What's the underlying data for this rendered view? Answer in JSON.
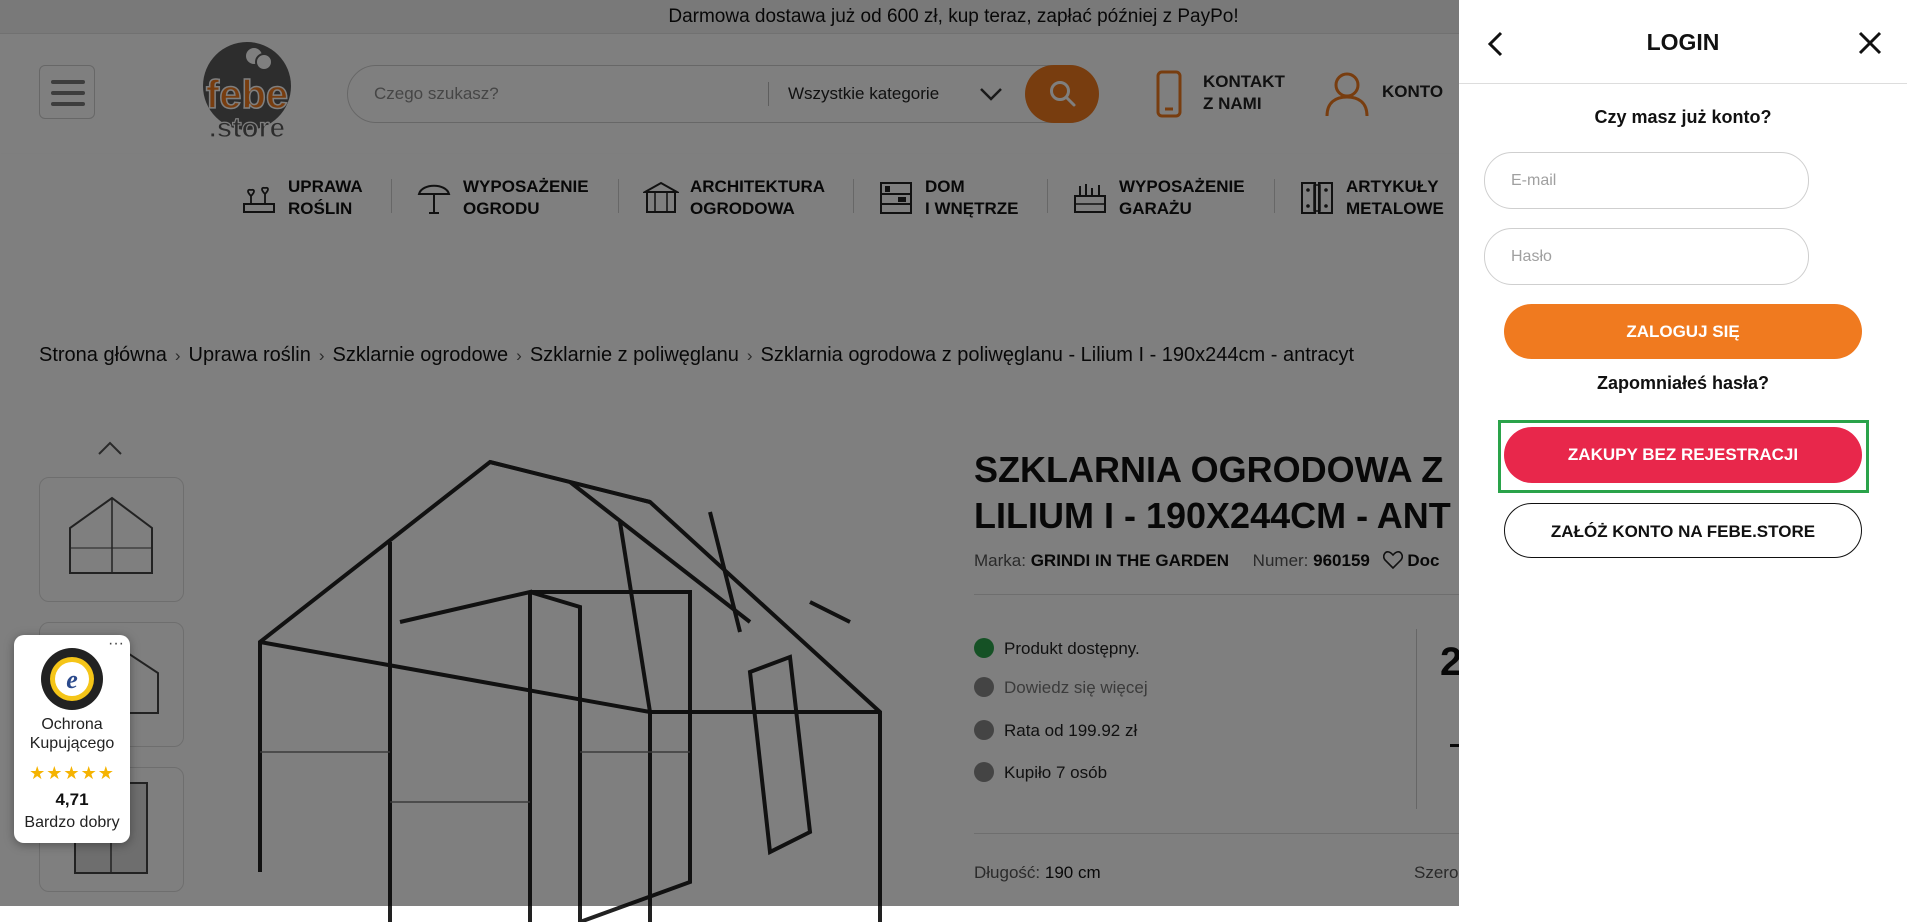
{
  "promo": {
    "text": "Darmowa dostawa już od 600 zł, kup teraz, zapłać później z PayPo!"
  },
  "header": {
    "logo_top": "febe",
    "logo_bottom": ".store",
    "search_placeholder": "Czego szukasz?",
    "search_category": "Wszystkie kategorie",
    "contact_line1": "KONTAKT",
    "contact_line2": "Z NAMI",
    "account_label": "KONTO"
  },
  "categories": [
    {
      "line1": "UPRAWA",
      "line2": "ROŚLIN",
      "icon": "seedling-tray-icon"
    },
    {
      "line1": "WYPOSAŻENIE",
      "line2": "OGRODU",
      "icon": "parasol-icon"
    },
    {
      "line1": "ARCHITEKTURA",
      "line2": "OGRODOWA",
      "icon": "pavilion-icon"
    },
    {
      "line1": "DOM",
      "line2": "I WNĘTRZE",
      "icon": "shelf-icon"
    },
    {
      "line1": "WYPOSAŻENIE",
      "line2": "GARAŻU",
      "icon": "toolbox-icon"
    },
    {
      "line1": "ARTYKUŁY",
      "line2": "METALOWE",
      "icon": "hinge-icon"
    }
  ],
  "breadcrumb": [
    "Strona główna",
    "Uprawa roślin",
    "Szklarnie ogrodowe",
    "Szklarnie z poliwęglanu",
    "Szklarnia ogrodowa z poliwęglanu - Lilium I - 190x244cm - antracyt"
  ],
  "product": {
    "title_line1": "SZKLARNIA OGRODOWA Z",
    "title_line2": "LILIUM I - 190X244CM - ANT",
    "brand_label": "Marka:",
    "brand": "GRINDI IN THE GARDEN",
    "number_label": "Numer:",
    "number": "960159",
    "wishlist": "Doc",
    "features": [
      {
        "text": "Produkt dostępny.",
        "color": "#2aa34a"
      },
      {
        "text": "Dowiedz się więcej",
        "color": "#888888"
      },
      {
        "text": "Rata od 199.92 zł",
        "color": "#888888"
      },
      {
        "text": "Kupiło 7 osób",
        "color": "#888888"
      }
    ],
    "price_fragment": "2",
    "length_label": "Długość:",
    "length": "190 cm",
    "width_label": "Szero"
  },
  "trust": {
    "label": "Ochrona Kupującego",
    "stars": "★★★★★",
    "score": "4,71",
    "rating": "Bardzo dobry",
    "menu": "···"
  },
  "login": {
    "title": "LOGIN",
    "question": "Czy masz już konto?",
    "email_placeholder": "E-mail",
    "password_placeholder": "Hasło",
    "login_button": "ZALOGUJ SIĘ",
    "forgot": "Zapomniałeś hasła?",
    "guest_button": "ZAKUPY BEZ REJESTRACJI",
    "register_button": "ZAŁÓŻ KONTO NA FEBE.STORE"
  },
  "colors": {
    "accent": "#f07a1f",
    "guest": "#e8274b",
    "highlight": "#2aa34a"
  }
}
